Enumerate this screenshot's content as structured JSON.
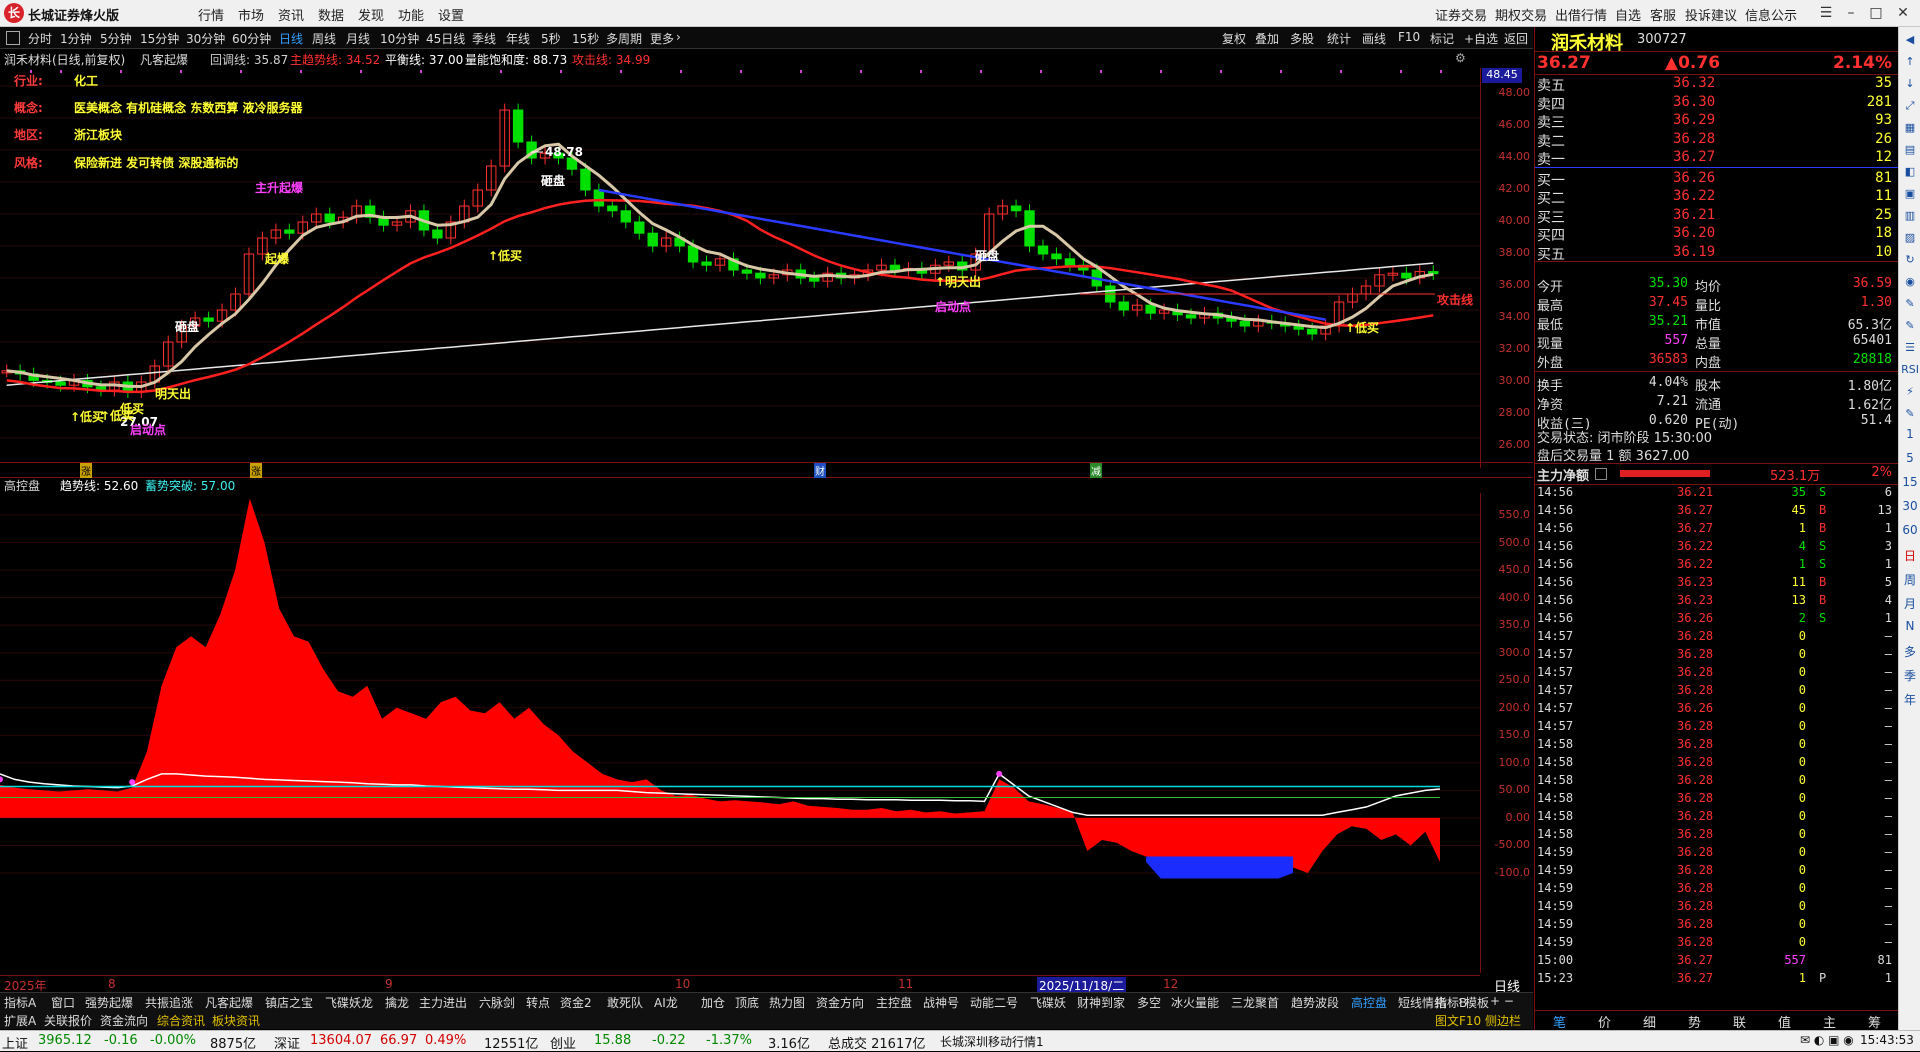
{
  "window": {
    "title": "长城证券烽火版",
    "menu": [
      "行情",
      "市场",
      "资讯",
      "数据",
      "发现",
      "功能",
      "设置"
    ],
    "right_menu": [
      "证券交易",
      "期权交易",
      "出借行情",
      "自选",
      "客服",
      "投诉建议",
      "信息公示"
    ]
  },
  "toolbar": {
    "periods": [
      "分时",
      "1分钟",
      "5分钟",
      "15分钟",
      "30分钟",
      "60分钟",
      "日线",
      "周线",
      "月线",
      "10分钟",
      "45日线",
      "季线",
      "年线",
      "5秒",
      "15秒",
      "多周期",
      "更多"
    ],
    "active_period": "日线",
    "tools": [
      "复权",
      "叠加",
      "多股",
      "统计",
      "画线",
      "F10",
      "标记",
      "+自选",
      "返回"
    ]
  },
  "chart": {
    "stock_line": "润禾材料(日线,前复权)",
    "indicator_name": "凡客起爆",
    "indicators": [
      {
        "label": "回调线: 35.87",
        "color": "#d0d0d0"
      },
      {
        "label": "主趋势线: 34.52",
        "color": "#ff3030"
      },
      {
        "label": "平衡线: 37.00",
        "color": "#ffffff"
      },
      {
        "label": "量能饱和度: 88.73",
        "color": "#ffffff"
      },
      {
        "label": "攻击线: 34.99",
        "color": "#ff3030"
      }
    ],
    "info": [
      {
        "key": "行业:",
        "val": "化工"
      },
      {
        "key": "概念:",
        "val": "医美概念 有机硅概念 东数西算 液冷服务器"
      },
      {
        "key": "地区:",
        "val": "浙江板块"
      },
      {
        "key": "风格:",
        "val": "保险新进 发可转债 深股通标的"
      }
    ],
    "yticks": [
      "48.00",
      "46.00",
      "44.00",
      "42.00",
      "40.00",
      "38.00",
      "36.00",
      "34.00",
      "32.00",
      "30.00",
      "28.00",
      "26.00"
    ],
    "price_box": "48.45",
    "annotations": {
      "high": "48.78",
      "low": "27.07",
      "attack_line": "攻击线",
      "labels": [
        "砸盘",
        "砸盘",
        "砸盘",
        "主升起爆",
        "起爆",
        "明天出",
        "↑低买",
        "↑低买",
        "↑低买",
        "↑低买",
        "↑明天出",
        "启动点",
        "启动点",
        "低买"
      ]
    },
    "markers": [
      "涨",
      "涨",
      "财",
      "减"
    ]
  },
  "subchart": {
    "name": "高控盘",
    "trend": "趋势线: 52.60",
    "breakout": "蓄势突破: 57.00",
    "yticks": [
      "550.0",
      "500.0",
      "450.0",
      "400.0",
      "350.0",
      "300.0",
      "250.0",
      "200.0",
      "150.0",
      "100.0",
      "50.00",
      "0.00",
      "-50.00",
      "-100.0"
    ],
    "chart_data": {
      "type": "area",
      "title": "高控盘",
      "x": [
        0,
        1,
        2,
        3,
        4,
        5,
        6,
        7,
        8,
        9,
        10,
        11,
        12,
        13,
        14,
        15,
        16,
        17,
        18,
        19,
        20,
        21,
        22,
        23,
        24,
        25,
        26,
        27,
        28,
        29,
        30,
        31,
        32,
        33,
        34,
        35,
        36,
        37,
        38,
        39,
        40,
        41,
        42,
        43,
        44,
        45,
        46,
        47,
        48,
        49,
        50,
        51,
        52,
        53,
        54,
        55,
        56,
        57,
        58,
        59,
        60,
        61,
        62,
        63,
        64,
        65,
        66,
        67,
        68,
        69,
        70,
        71,
        72,
        73,
        74,
        75,
        76,
        77,
        78,
        79,
        80,
        81,
        82,
        83,
        84,
        85,
        86,
        87,
        88,
        89,
        90,
        91,
        92,
        93,
        94,
        95,
        96,
        97,
        98
      ],
      "series": [
        {
          "name": "高控盘",
          "values": [
            60,
            55,
            52,
            50,
            48,
            50,
            52,
            50,
            48,
            55,
            120,
            240,
            310,
            330,
            310,
            370,
            450,
            580,
            500,
            380,
            330,
            320,
            270,
            230,
            220,
            240,
            180,
            200,
            190,
            180,
            210,
            220,
            195,
            190,
            210,
            180,
            200,
            170,
            150,
            120,
            100,
            80,
            70,
            65,
            70,
            50,
            40,
            42,
            35,
            30,
            32,
            30,
            28,
            25,
            30,
            22,
            20,
            18,
            15,
            15,
            18,
            12,
            15,
            10,
            12,
            8,
            10,
            12,
            70,
            55,
            30,
            25,
            18,
            10,
            -60,
            -40,
            -45,
            -60,
            -70,
            -100,
            -100,
            -100,
            -100,
            -100,
            -100,
            -100,
            -100,
            -100,
            -90,
            -100,
            -60,
            -30,
            -15,
            -20,
            -40,
            -30,
            -50,
            -25,
            -80
          ]
        },
        {
          "name": "趋势线",
          "values": [
            80,
            70,
            65,
            62,
            60,
            58,
            57,
            56,
            55,
            58,
            70,
            80,
            80,
            78,
            76,
            75,
            74,
            72,
            70,
            69,
            68,
            67,
            66,
            65,
            64,
            62,
            61,
            60,
            60,
            58,
            57,
            56,
            55,
            54,
            53,
            52,
            52,
            51,
            50,
            50,
            50,
            50,
            50,
            48,
            46,
            45,
            44,
            43,
            42,
            41,
            40,
            39,
            38,
            37,
            36,
            35,
            35,
            34,
            34,
            33,
            33,
            33,
            32,
            32,
            32,
            31,
            31,
            30,
            80,
            60,
            40,
            30,
            20,
            10,
            5,
            5,
            5,
            5,
            5,
            5,
            5,
            5,
            5,
            5,
            5,
            5,
            5,
            5,
            5,
            5,
            5,
            10,
            15,
            20,
            30,
            40,
            45,
            50,
            52.6
          ]
        },
        {
          "name": "蓄势突破",
          "values": [
            57,
            57,
            57,
            57,
            57,
            57,
            57,
            57,
            57,
            57,
            57,
            57,
            57,
            57,
            57,
            57,
            57,
            57,
            57,
            57,
            57,
            57,
            57,
            57,
            57,
            57,
            57,
            57,
            57,
            57,
            57,
            57,
            57,
            57,
            57,
            57,
            57,
            57,
            57,
            57,
            57,
            57,
            57,
            57,
            57,
            57,
            57,
            57,
            57,
            57,
            57,
            57,
            57,
            57,
            57,
            57,
            57,
            57,
            57,
            57,
            57,
            57,
            57,
            57,
            57,
            57,
            57,
            57,
            57,
            57,
            57,
            57,
            57,
            57,
            57,
            57,
            57,
            57,
            57,
            57,
            57,
            57,
            57,
            57,
            57,
            57,
            57,
            57,
            57,
            57,
            57,
            57,
            57,
            57,
            57,
            57,
            57,
            57,
            57
          ]
        }
      ],
      "ylim": [
        -100,
        600
      ]
    }
  },
  "xaxis": [
    "2025年",
    "8",
    "9",
    "10",
    "11",
    "2025/11/18/二",
    "12"
  ],
  "yaxis_label_right": "日线",
  "tabs1": [
    "指标A",
    "窗口",
    "强势起爆",
    "共振追涨",
    "凡客起爆",
    "镇店之宝",
    "飞碟妖龙",
    "擒龙",
    "主力进出",
    "六脉剑",
    "转点",
    "资金2",
    "敢死队",
    "AI龙",
    "加仓",
    "顶底",
    "热力图",
    "资金方向",
    "主控盘",
    "战神号",
    "动能二号",
    "飞碟妖",
    "财神到家",
    "多空",
    "冰火量能",
    "三龙聚首",
    "趋势波段",
    "高控盘",
    "短线情绪"
  ],
  "tabs1_active": "高控盘",
  "tabs1_right": [
    "指标B",
    "模板"
  ],
  "tabs2": [
    "扩展A",
    "关联报价",
    "资金流向",
    "综合资讯",
    "板块资讯"
  ],
  "tabs2_right": "图文F10 侧边栏",
  "quote": {
    "name": "润禾材料",
    "code": "300727",
    "price": "36.27",
    "change": "▲0.76",
    "pct": "2.14%",
    "asks": [
      {
        "label": "卖五",
        "price": "36.32",
        "vol": "35"
      },
      {
        "label": "卖四",
        "price": "36.30",
        "vol": "281"
      },
      {
        "label": "卖三",
        "price": "36.29",
        "vol": "93"
      },
      {
        "label": "卖二",
        "price": "36.28",
        "vol": "26"
      },
      {
        "label": "卖一",
        "price": "36.27",
        "vol": "12"
      }
    ],
    "bids": [
      {
        "label": "买一",
        "price": "36.26",
        "vol": "81"
      },
      {
        "label": "买二",
        "price": "36.22",
        "vol": "11"
      },
      {
        "label": "买三",
        "price": "36.21",
        "vol": "25"
      },
      {
        "label": "买四",
        "price": "36.20",
        "vol": "18"
      },
      {
        "label": "买五",
        "price": "36.19",
        "vol": "10"
      }
    ],
    "stats": [
      {
        "k1": "今开",
        "v1": "35.30",
        "k2": "均价",
        "v2": "36.59"
      },
      {
        "k1": "最高",
        "v1": "37.45",
        "k2": "量比",
        "v2": "1.30"
      },
      {
        "k1": "最低",
        "v1": "35.21",
        "k2": "市值",
        "v2": "65.3亿"
      },
      {
        "k1": "现量",
        "v1": "557",
        "k2": "总量",
        "v2": "65401"
      },
      {
        "k1": "外盘",
        "v1": "36583",
        "k2": "内盘",
        "v2": "28818"
      },
      {
        "k1": "换手",
        "v1": "4.04%",
        "k2": "股本",
        "v2": "1.80亿"
      },
      {
        "k1": "净资",
        "v1": "7.21",
        "k2": "流通",
        "v2": "1.62亿"
      },
      {
        "k1": "收益(三)",
        "v1": "0.620",
        "k2": "PE(动)",
        "v2": "51.4"
      }
    ],
    "trade_status": "交易状态: 闭市阶段 15:30:00",
    "after_hours": "盘后交易量 1 额 3627.00",
    "main_net_label": "主力净额",
    "main_net_value": "523.1万",
    "main_net_pct": "2%",
    "ticks": [
      {
        "t": "14:56",
        "p": "36.21",
        "v": "35",
        "d": "S",
        "n": "6"
      },
      {
        "t": "14:56",
        "p": "36.27",
        "v": "45",
        "d": "B",
        "n": "13"
      },
      {
        "t": "14:56",
        "p": "36.27",
        "v": "1",
        "d": "B",
        "n": "1"
      },
      {
        "t": "14:56",
        "p": "36.22",
        "v": "4",
        "d": "S",
        "n": "3"
      },
      {
        "t": "14:56",
        "p": "36.22",
        "v": "1",
        "d": "S",
        "n": "1"
      },
      {
        "t": "14:56",
        "p": "36.23",
        "v": "11",
        "d": "B",
        "n": "5"
      },
      {
        "t": "14:56",
        "p": "36.23",
        "v": "13",
        "d": "B",
        "n": "4"
      },
      {
        "t": "14:56",
        "p": "36.26",
        "v": "2",
        "d": "S",
        "n": "1"
      },
      {
        "t": "14:57",
        "p": "36.28",
        "v": "0",
        "d": "",
        "n": "—"
      },
      {
        "t": "14:57",
        "p": "36.28",
        "v": "0",
        "d": "",
        "n": "—"
      },
      {
        "t": "14:57",
        "p": "36.28",
        "v": "0",
        "d": "",
        "n": "—"
      },
      {
        "t": "14:57",
        "p": "36.28",
        "v": "0",
        "d": "",
        "n": "—"
      },
      {
        "t": "14:57",
        "p": "36.26",
        "v": "0",
        "d": "",
        "n": "—"
      },
      {
        "t": "14:57",
        "p": "36.28",
        "v": "0",
        "d": "",
        "n": "—"
      },
      {
        "t": "14:58",
        "p": "36.28",
        "v": "0",
        "d": "",
        "n": "—"
      },
      {
        "t": "14:58",
        "p": "36.28",
        "v": "0",
        "d": "",
        "n": "—"
      },
      {
        "t": "14:58",
        "p": "36.28",
        "v": "0",
        "d": "",
        "n": "—"
      },
      {
        "t": "14:58",
        "p": "36.28",
        "v": "0",
        "d": "",
        "n": "—"
      },
      {
        "t": "14:58",
        "p": "36.28",
        "v": "0",
        "d": "",
        "n": "—"
      },
      {
        "t": "14:58",
        "p": "36.28",
        "v": "0",
        "d": "",
        "n": "—"
      },
      {
        "t": "14:59",
        "p": "36.28",
        "v": "0",
        "d": "",
        "n": "—"
      },
      {
        "t": "14:59",
        "p": "36.28",
        "v": "0",
        "d": "",
        "n": "—"
      },
      {
        "t": "14:59",
        "p": "36.28",
        "v": "0",
        "d": "",
        "n": "—"
      },
      {
        "t": "14:59",
        "p": "36.28",
        "v": "0",
        "d": "",
        "n": "—"
      },
      {
        "t": "14:59",
        "p": "36.28",
        "v": "0",
        "d": "",
        "n": "—"
      },
      {
        "t": "14:59",
        "p": "36.28",
        "v": "0",
        "d": "",
        "n": "—"
      },
      {
        "t": "15:00",
        "p": "36.27",
        "v": "557",
        "d": "",
        "n": "81"
      },
      {
        "t": "15:23",
        "p": "36.27",
        "v": "1",
        "d": "P",
        "n": "1"
      }
    ],
    "bottom_tabs": [
      "笔",
      "价",
      "细",
      "势",
      "联",
      "值",
      "主",
      "筹"
    ]
  },
  "sidebar": [
    "1",
    "5",
    "15",
    "30",
    "60",
    "日",
    "周",
    "月",
    "N",
    "多",
    "季",
    "年"
  ],
  "status": {
    "sh_label": "上证",
    "sh_val": "3965.12",
    "sh_chg": "-0.16",
    "sh_pct": "-0.00%",
    "sh_amt": "8875亿",
    "sz_label": "深证",
    "sz_val": "13604.07",
    "sz_chg": "66.97",
    "sz_pct": "0.49%",
    "sz_amt": "12551亿",
    "cy_label": "创业",
    "cy_val": "15.88",
    "cy_chg": "-0.22",
    "cy_pct": "-1.37%",
    "cy_amt": "3.16亿",
    "total": "总成交 21617亿",
    "broker": "长城深圳移动行情1",
    "time": "15:43:53"
  }
}
